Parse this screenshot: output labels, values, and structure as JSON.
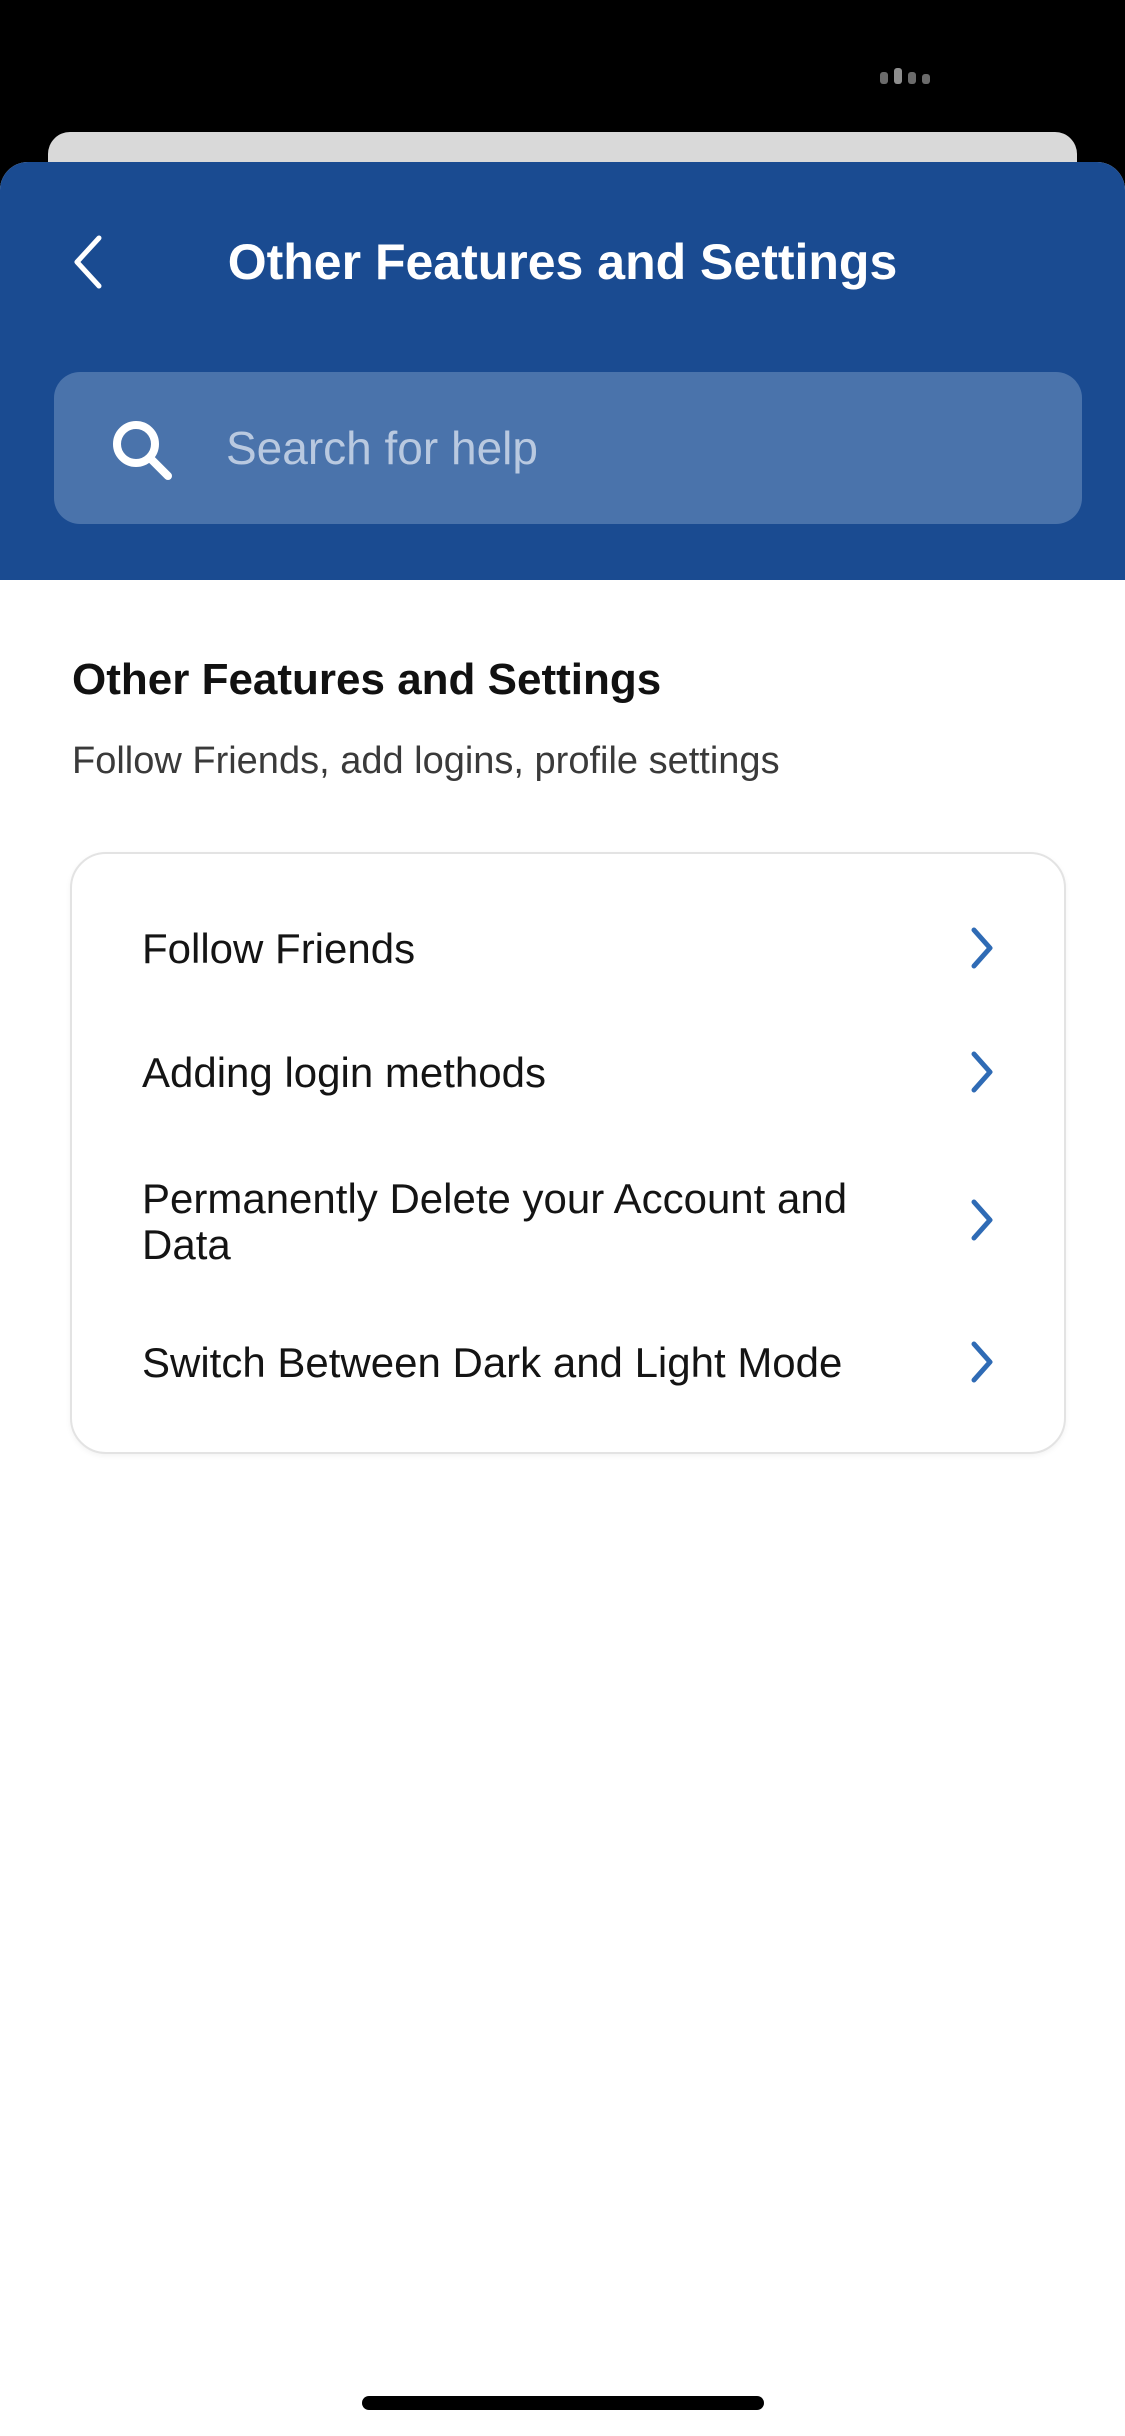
{
  "header": {
    "title": "Other Features and Settings",
    "back_icon": "chevron-left-icon"
  },
  "search": {
    "placeholder": "Search for help",
    "value": "",
    "icon": "search-icon"
  },
  "section": {
    "title": "Other Features and Settings",
    "subtitle": "Follow Friends, add logins, profile settings"
  },
  "articles": [
    {
      "label": "Follow Friends"
    },
    {
      "label": "Adding login methods"
    },
    {
      "label": "Permanently Delete your Account and Data"
    },
    {
      "label": "Switch Between Dark and Light Mode"
    }
  ],
  "colors": {
    "brand_blue": "#1a4b91",
    "search_bg": "#4a73ab",
    "chevron_blue": "#2f6bb5"
  }
}
